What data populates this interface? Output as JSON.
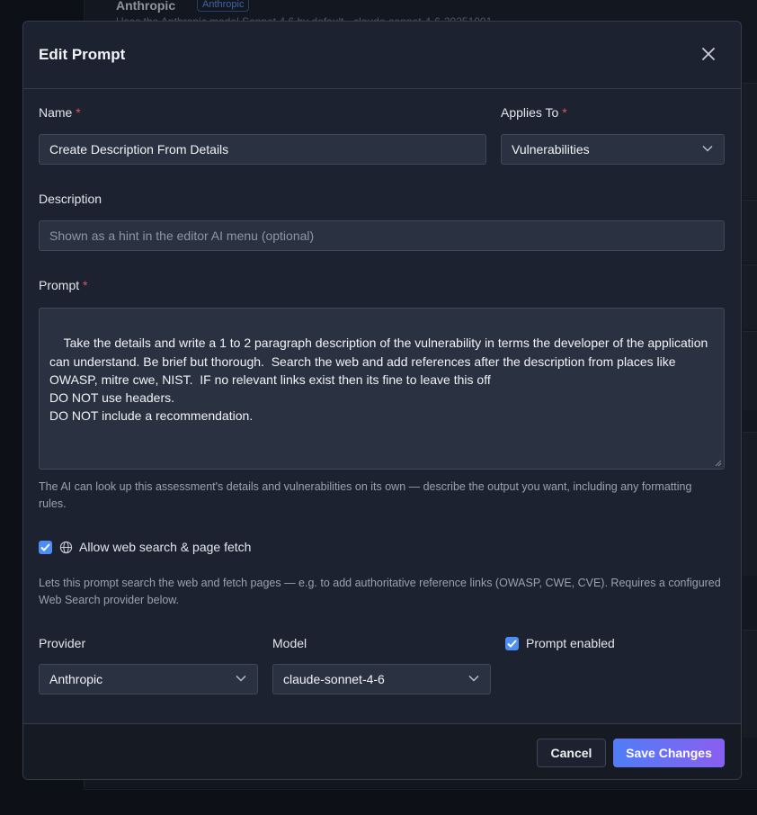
{
  "background": {
    "card_title": "Anthropic",
    "card_badge": "Anthropic",
    "card_subtitle": "Uses the Anthropic model Sonnet 4.6 by default · claude-sonnet-4-6-20251001"
  },
  "modal": {
    "title": "Edit Prompt",
    "close_icon": "close-icon"
  },
  "form": {
    "name": {
      "label": "Name",
      "required_mark": "*",
      "value": "Create Description From Details"
    },
    "applies_to": {
      "label": "Applies To",
      "required_mark": "*",
      "value": "Vulnerabilities"
    },
    "description": {
      "label": "Description",
      "placeholder": "Shown as a hint in the editor AI menu (optional)",
      "value": ""
    },
    "prompt": {
      "label": "Prompt",
      "required_mark": "*",
      "value": "Take the details and write a 1 to 2 paragraph description of the vulnerability in terms the developer of the application can understand. Be brief but thorough.  Search the web and add references after the description from places like OWASP, mitre cwe, NIST.  IF no relevant links exist then its fine to leave this off\nDO NOT use headers.\nDO NOT include a recommendation.",
      "help": "The AI can look up this assessment's details and vulnerabilities on its own — describe the output you want, including any formatting rules."
    },
    "web_search": {
      "checked": true,
      "icon": "globe-icon",
      "label": "Allow web search & page fetch",
      "help": "Lets this prompt search the web and fetch pages — e.g. to add authoritative reference links (OWASP, CWE, CVE). Requires a configured Web Search provider below."
    },
    "provider": {
      "label": "Provider",
      "value": "Anthropic"
    },
    "model": {
      "label": "Model",
      "value": "claude-sonnet-4-6"
    },
    "prompt_enabled": {
      "checked": true,
      "label": "Prompt enabled"
    }
  },
  "footer": {
    "cancel_label": "Cancel",
    "save_label": "Save Changes"
  },
  "colors": {
    "accent": "#4c8ef5",
    "required": "#e05561",
    "save_gradient_start": "#4f7ef7",
    "save_gradient_end": "#8a5ef0"
  }
}
